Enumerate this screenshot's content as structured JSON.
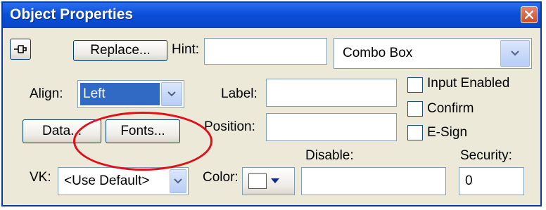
{
  "window": {
    "title": "Object Properties"
  },
  "toolbar": {
    "replace_label": "Replace...",
    "hint_label": "Hint:",
    "hint_value": ""
  },
  "type_select": {
    "value": "Combo Box"
  },
  "align": {
    "label": "Align:",
    "value": "Left"
  },
  "label_field": {
    "label": "Label:",
    "value": ""
  },
  "position_field": {
    "label": "Position:",
    "value": ""
  },
  "checkboxes": [
    {
      "label": "Input Enabled",
      "checked": false
    },
    {
      "label": "Confirm",
      "checked": false
    },
    {
      "label": "E-Sign",
      "checked": false
    }
  ],
  "buttons": {
    "data_label": "Data...",
    "fonts_label": "Fonts..."
  },
  "disable": {
    "label": "Disable:",
    "value": ""
  },
  "security": {
    "label": "Security:",
    "value": "0"
  },
  "vk": {
    "label": "VK:",
    "value": "<Use Default>"
  },
  "color": {
    "label": "Color:",
    "swatch": "#ffffff",
    "arrow_color": "#0a2a8c"
  },
  "annotation": {
    "color": "#e0101a"
  },
  "icons": {
    "close": "close-icon",
    "pin": "pin-icon",
    "dropdown": "chevron-down-icon"
  }
}
